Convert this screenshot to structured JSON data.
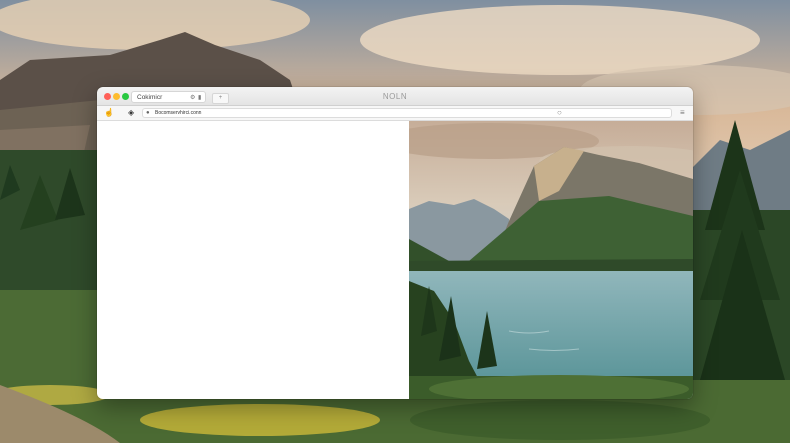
{
  "window": {
    "title": "NOLN",
    "traffic_lights": {
      "close": "#ff5f57",
      "minimize": "#febc2e",
      "maximize": "#28c840"
    }
  },
  "tab": {
    "label": "Cokimicr",
    "icon_a": "tab-settings-icon",
    "icon_b": "tab-close-icon",
    "new_tab_label": "+"
  },
  "toolbar": {
    "back_icon": "hand-icon",
    "nav_icon": "diamond-icon",
    "address": {
      "value": "Bocomservhirci.conn",
      "lock_icon": "lock-icon",
      "reload_icon": "reload-icon"
    },
    "menu_icon": "sidebar-menu-icon"
  },
  "content": {
    "left_panel": "blank"
  }
}
